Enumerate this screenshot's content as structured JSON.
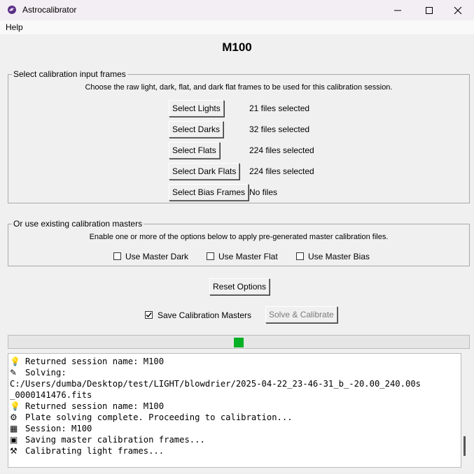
{
  "window": {
    "title": "Astrocalibrator"
  },
  "menu": {
    "help": "Help"
  },
  "session": {
    "name": "M100"
  },
  "input_frames": {
    "legend": "Select calibration input frames",
    "description": "Choose the raw light, dark, flat, and dark flat frames to be used for this calibration session.",
    "rows": [
      {
        "button": "Select Lights",
        "status": "21 files selected"
      },
      {
        "button": "Select Darks",
        "status": "32 files selected"
      },
      {
        "button": "Select Flats",
        "status": "224 files selected"
      },
      {
        "button": "Select Dark Flats",
        "status": "224 files selected"
      },
      {
        "button": "Select Bias Frames",
        "status": "No files"
      }
    ]
  },
  "masters": {
    "legend": "Or use existing calibration masters",
    "description": "Enable one or more of the options below to apply pre-generated master calibration files.",
    "options": [
      {
        "label": "Use Master Dark",
        "checked": false
      },
      {
        "label": "Use Master Flat",
        "checked": false
      },
      {
        "label": "Use Master Bias",
        "checked": false
      }
    ]
  },
  "actions": {
    "reset": "Reset Options",
    "save_masters": "Save Calibration Masters",
    "save_masters_checked": true,
    "solve": "Solve & Calibrate"
  },
  "progress": {
    "fraction": 0.5,
    "color": "#06b025"
  },
  "log": {
    "lines": [
      {
        "icon": "lightbulb-icon",
        "text": "Returned session name: M100"
      },
      {
        "icon": "pen-icon",
        "text": "Solving:"
      },
      {
        "icon": "",
        "text": "C:/Users/dumba/Desktop/test/LIGHT/blowdrier/2025-04-22_23-46-31_b_-20.00_240.00s"
      },
      {
        "icon": "",
        "text": "_0000141476.fits"
      },
      {
        "icon": "lightbulb-icon",
        "text": "Returned session name: M100"
      },
      {
        "icon": "gear-icon",
        "text": "Plate solving complete. Proceeding to calibration..."
      },
      {
        "icon": "calendar-icon",
        "text": "Session: M100"
      },
      {
        "icon": "floppy-icon",
        "text": "Saving master calibration frames..."
      },
      {
        "icon": "wrench-icon",
        "text": "Calibrating light frames..."
      }
    ]
  }
}
